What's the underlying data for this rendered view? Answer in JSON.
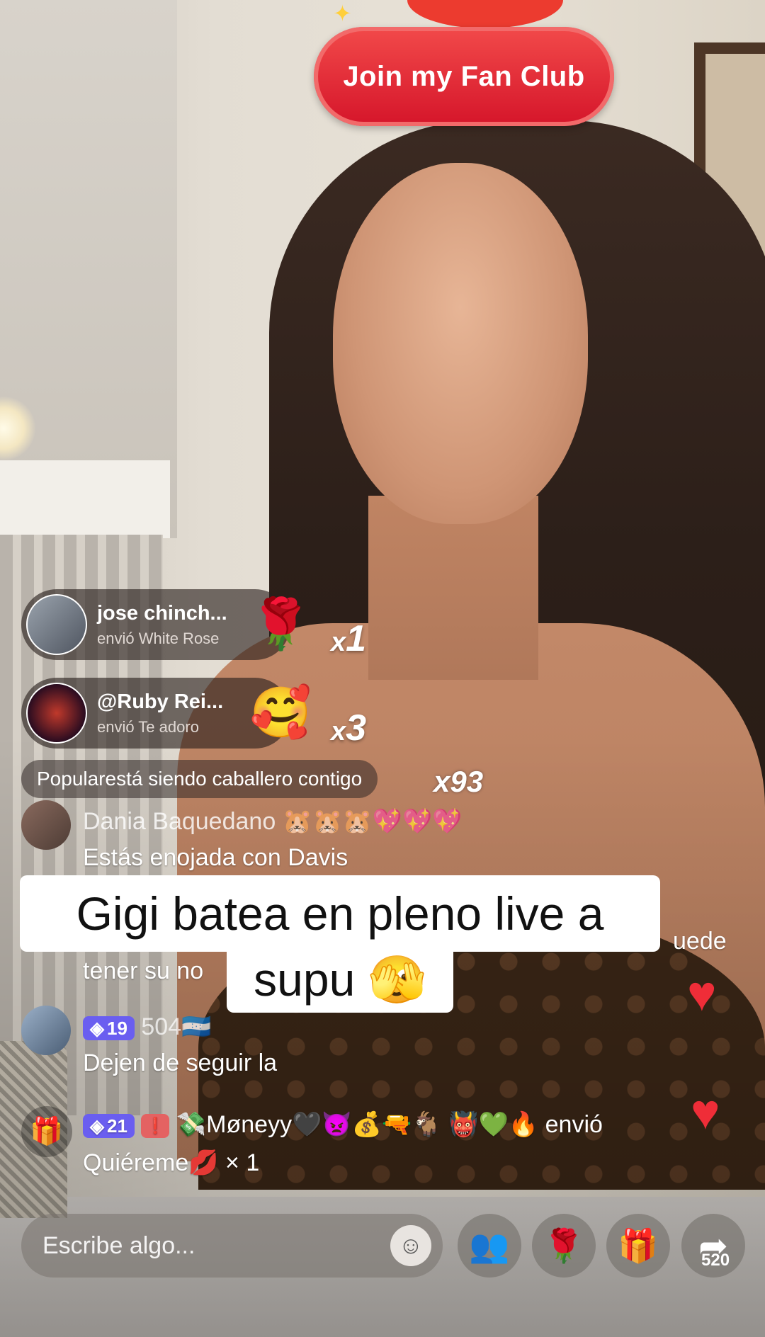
{
  "fan_club": {
    "label": "Join my Fan Club"
  },
  "gifts": [
    {
      "user": "jose chinch...",
      "sub": "envió White Rose",
      "item_icon": "white-rose-icon",
      "item_glyph": "🌹",
      "x": "x",
      "count": "1"
    },
    {
      "user": "@Ruby Rei...",
      "sub": "envió Te adoro",
      "item_icon": "heart-hug-icon",
      "item_glyph": "🥰",
      "x": "x",
      "count": "3"
    }
  ],
  "popular": {
    "label": "Popular",
    "text": " está siendo caballero contigo",
    "count": "x93"
  },
  "comments": [
    {
      "name": "Dania Baquedano 🐹🐹🐹💖💖💖",
      "text": "Estás enojada con Davis"
    },
    {
      "text": "uede"
    },
    {
      "text": "tener su no"
    },
    {
      "badge_level": "19",
      "name": "504🇭🇳",
      "text": "Dejen de seguir la"
    },
    {
      "badge_level": "21",
      "badge2": "❗",
      "name": "💸Møneyy🖤👿💰🔫🐐 👹💚🔥 envió",
      "text": "Quiéreme💋 × 1"
    }
  ],
  "caption": {
    "line1": "Gigi  batea en pleno live a",
    "line2": "supu 🫣"
  },
  "input": {
    "placeholder": "Escribe algo..."
  },
  "share": {
    "count": "520"
  },
  "colors": {
    "accent_red": "#d5152a",
    "heart": "#ef2d38",
    "badge": "#6a5ef0"
  }
}
